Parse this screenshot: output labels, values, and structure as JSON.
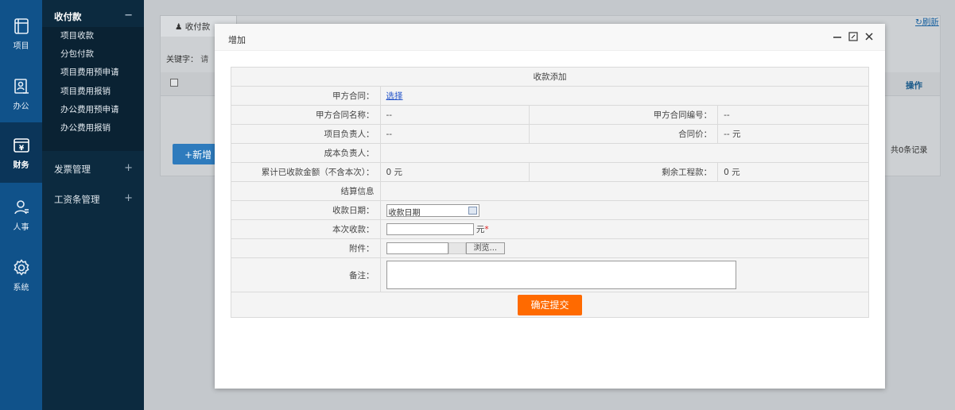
{
  "rail": [
    {
      "label": "项目",
      "icon": "project-icon"
    },
    {
      "label": "办公",
      "icon": "office-icon"
    },
    {
      "label": "财务",
      "icon": "finance-icon",
      "active": true
    },
    {
      "label": "人事",
      "icon": "user-icon"
    },
    {
      "label": "系统",
      "icon": "gear-icon"
    }
  ],
  "menu": {
    "group_open": {
      "label": "收付款",
      "sign": "−"
    },
    "items": [
      "项目收款",
      "分包付款",
      "项目费用预申请",
      "项目费用报销",
      "办公费用预申请",
      "办公费用报销"
    ],
    "group_invoice": {
      "label": "发票管理",
      "sign": "+"
    },
    "group_salary": {
      "label": "工资条管理",
      "sign": "+"
    }
  },
  "background": {
    "tab_label": "收付款",
    "keyword_label": "关键字：",
    "keyword_hint": "请",
    "operation_header": "操作",
    "new_button": "新增",
    "record_count": "共0条记录",
    "refresh": "刷新"
  },
  "modal": {
    "title": "增加",
    "form_title": "收款添加",
    "contract_label": "甲方合同：",
    "contract_select": "选择",
    "contract_name_label": "甲方合同名称：",
    "contract_name_value": "--",
    "contract_no_label": "甲方合同编号：",
    "contract_no_value": "--",
    "manager_label": "项目负责人：",
    "manager_value": "--",
    "price_label": "合同价：",
    "price_value": "-- 元",
    "cost_manager_label": "成本负责人：",
    "received_label": "累计已收款金额（不含本次）：",
    "received_value": "0 元",
    "remaining_label": "剩余工程款：",
    "remaining_value": "0 元",
    "settlement_label": "结算信息",
    "date_label": "收款日期：",
    "date_placeholder": "收款日期",
    "amount_label": "本次收款：",
    "amount_unit": "元",
    "amount_required": "*",
    "attachment_label": "附件：",
    "browse_button": "浏览...",
    "remark_label": "备注：",
    "submit_button": "确定提交"
  },
  "colors": {
    "rail_bg": "#10528a",
    "menu_bg": "#0c2a3f",
    "submit": "#ff6a00",
    "link": "#1f50c8"
  }
}
